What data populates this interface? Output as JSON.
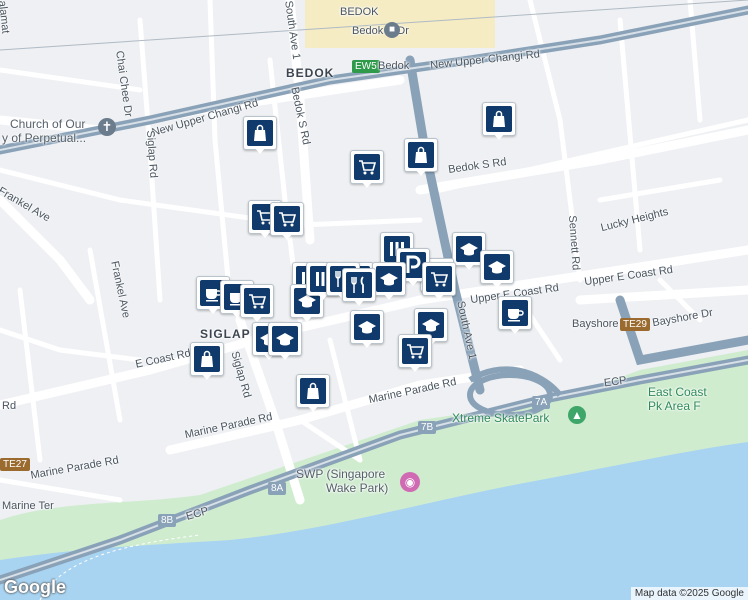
{
  "map": {
    "attribution": "Map data ©2025 Google",
    "logo": "Google",
    "labels": {
      "bedok_top": "BEDOK",
      "bedok_area": "BEDOK",
      "bedok_n_dr": "Bedok N Dr",
      "ew5": "EW5",
      "ew5_name": "Bedok",
      "new_upper_changi_rd_right": "New Upper Changi Rd",
      "new_upper_changi_rd_left": "New Upper Changi Rd",
      "bedok_s_rd_vertical": "Bedok S Rd",
      "bedok_s_rd": "Bedok S Rd",
      "south_ave_1_top": "South Ave 1",
      "south_ave_1": "South Ave 1",
      "chai_chee_dr": "Chai Chee Dr",
      "siglap_rd_top": "Siglap Rd",
      "siglap_rd": "Siglap Rd",
      "frankel_ave_a": "Frankel Ave",
      "frankel_ave_b": "Frankel Ave",
      "church_line1": "Church of Our",
      "church_line2": "y of Perpetual...",
      "jalan": "alamat",
      "siglap": "SIGLAP",
      "e_coast_rd": "E Coast Rd",
      "upper_e_coast_rd": "Upper E Coast Rd",
      "upper_e_coast_rd_b": "Upper E Coast Rd",
      "sennett_rd": "Sennett Rd",
      "lucky_heights": "Lucky Heights",
      "bayshore_rd": "Bayshore",
      "bayshore_dr": "Bayshore Dr",
      "te29": "TE29",
      "marine_parade_rd_a": "Marine Parade Rd",
      "marine_parade_rd_b": "Marine Parade Rd",
      "marine_parade_rd_c": "Marine Parade Rd",
      "rd_left": "Rd",
      "te27": "TE27",
      "marine_ter": "Marine Ter",
      "ecp_a": "ECP",
      "ecp_b": "ECP",
      "exit_8a": "8A",
      "exit_8b": "8B",
      "exit_7a": "7A",
      "exit_7b": "7B",
      "xtreme": "Xtreme SkatePark",
      "east_coast_1": "East Coast",
      "east_coast_2": "Pk Area F",
      "swp_1": "SWP (Singapore",
      "swp_2": "Wake Park)"
    },
    "colors": {
      "sea": "#a8d4f2",
      "park": "#cfeccf",
      "expressway": "#8aa2b8",
      "road": "#ffffff",
      "campus": "#f5ecc4",
      "pin": "#0f3a6b"
    },
    "pins": [
      {
        "icon": "shopping-bag",
        "name": "pin-shopping-bag-1"
      },
      {
        "icon": "shopping-bag",
        "name": "pin-shopping-bag-2"
      },
      {
        "icon": "shopping-cart",
        "name": "pin-shopping-cart-1"
      },
      {
        "icon": "shopping-bag",
        "name": "pin-shopping-bag-3"
      },
      {
        "icon": "shopping-cart",
        "name": "pin-shopping-cart-2"
      },
      {
        "icon": "shopping-cart",
        "name": "pin-shopping-cart-3"
      },
      {
        "icon": "bar",
        "name": "pin-bar-1"
      },
      {
        "icon": "school",
        "name": "pin-school-1"
      },
      {
        "icon": "shopping-cart",
        "name": "pin-shopping-cart-4"
      },
      {
        "icon": "school",
        "name": "pin-school-2"
      },
      {
        "icon": "parking",
        "name": "pin-parking-1"
      },
      {
        "icon": "bar",
        "name": "pin-bar-2"
      },
      {
        "icon": "restaurant",
        "name": "pin-restaurant-1"
      },
      {
        "icon": "school",
        "name": "pin-school-3"
      },
      {
        "icon": "shopping-cart",
        "name": "pin-shopping-cart-5"
      },
      {
        "icon": "cafe",
        "name": "pin-cafe-1"
      },
      {
        "icon": "shopping-bag",
        "name": "pin-shopping-bag-4"
      },
      {
        "icon": "cafe",
        "name": "pin-cafe-2"
      },
      {
        "icon": "cafe",
        "name": "pin-cafe-3"
      },
      {
        "icon": "shopping-cart",
        "name": "pin-shopping-cart-6"
      },
      {
        "icon": "school",
        "name": "pin-school-4"
      },
      {
        "icon": "school",
        "name": "pin-school-5"
      },
      {
        "icon": "bar",
        "name": "pin-bar-3"
      },
      {
        "icon": "restaurant",
        "name": "pin-restaurant-2"
      },
      {
        "icon": "restaurant",
        "name": "pin-restaurant-3"
      },
      {
        "icon": "school",
        "name": "pin-school-6"
      },
      {
        "icon": "school",
        "name": "pin-school-7"
      },
      {
        "icon": "school",
        "name": "pin-school-8"
      },
      {
        "icon": "shopping-cart",
        "name": "pin-shopping-cart-7"
      },
      {
        "icon": "shopping-bag",
        "name": "pin-shopping-bag-5"
      }
    ]
  }
}
